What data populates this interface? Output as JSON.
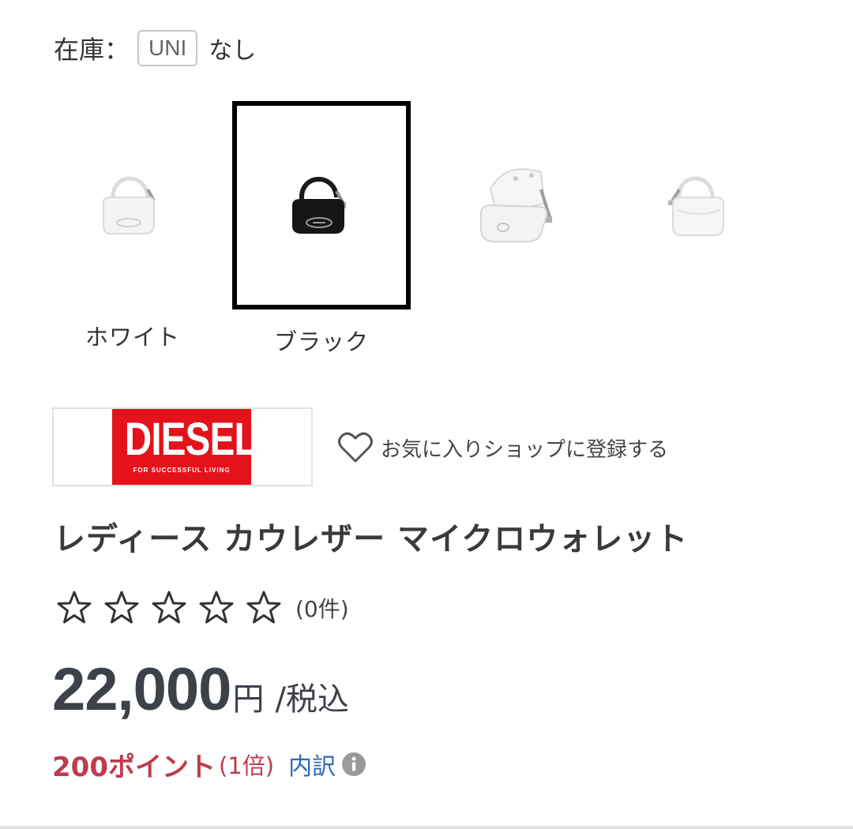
{
  "stock": {
    "label": "在庫：",
    "size": "UNI",
    "status": "なし"
  },
  "variants": [
    {
      "label": "ホワイト",
      "image": "white-bag-icon",
      "selected": false
    },
    {
      "label": "ブラック",
      "image": "black-bag-icon",
      "selected": true
    },
    {
      "label": "",
      "image": "white-bag-open-icon",
      "selected": false
    },
    {
      "label": "",
      "image": "white-bag-back-icon",
      "selected": false
    }
  ],
  "brand": {
    "logo_text": "DIESEL",
    "logo_tagline": "FOR SUCCESSFUL LIVING",
    "logo_color": "#e3121b",
    "favorite_label": "お気に入りショップに登録する"
  },
  "product": {
    "name": "レディース カウレザー マイクロウォレット",
    "rating_stars": 0,
    "rating_max": 5,
    "review_count": "(0件)",
    "price": "22,000",
    "currency": "円",
    "tax_note": "/税込",
    "points": "200ポイント",
    "points_multiplier": "(1倍)",
    "breakdown_label": "内訳"
  },
  "colors": {
    "points": "#bf3b4f",
    "link": "#2b6cb0",
    "price": "#3d4148"
  }
}
